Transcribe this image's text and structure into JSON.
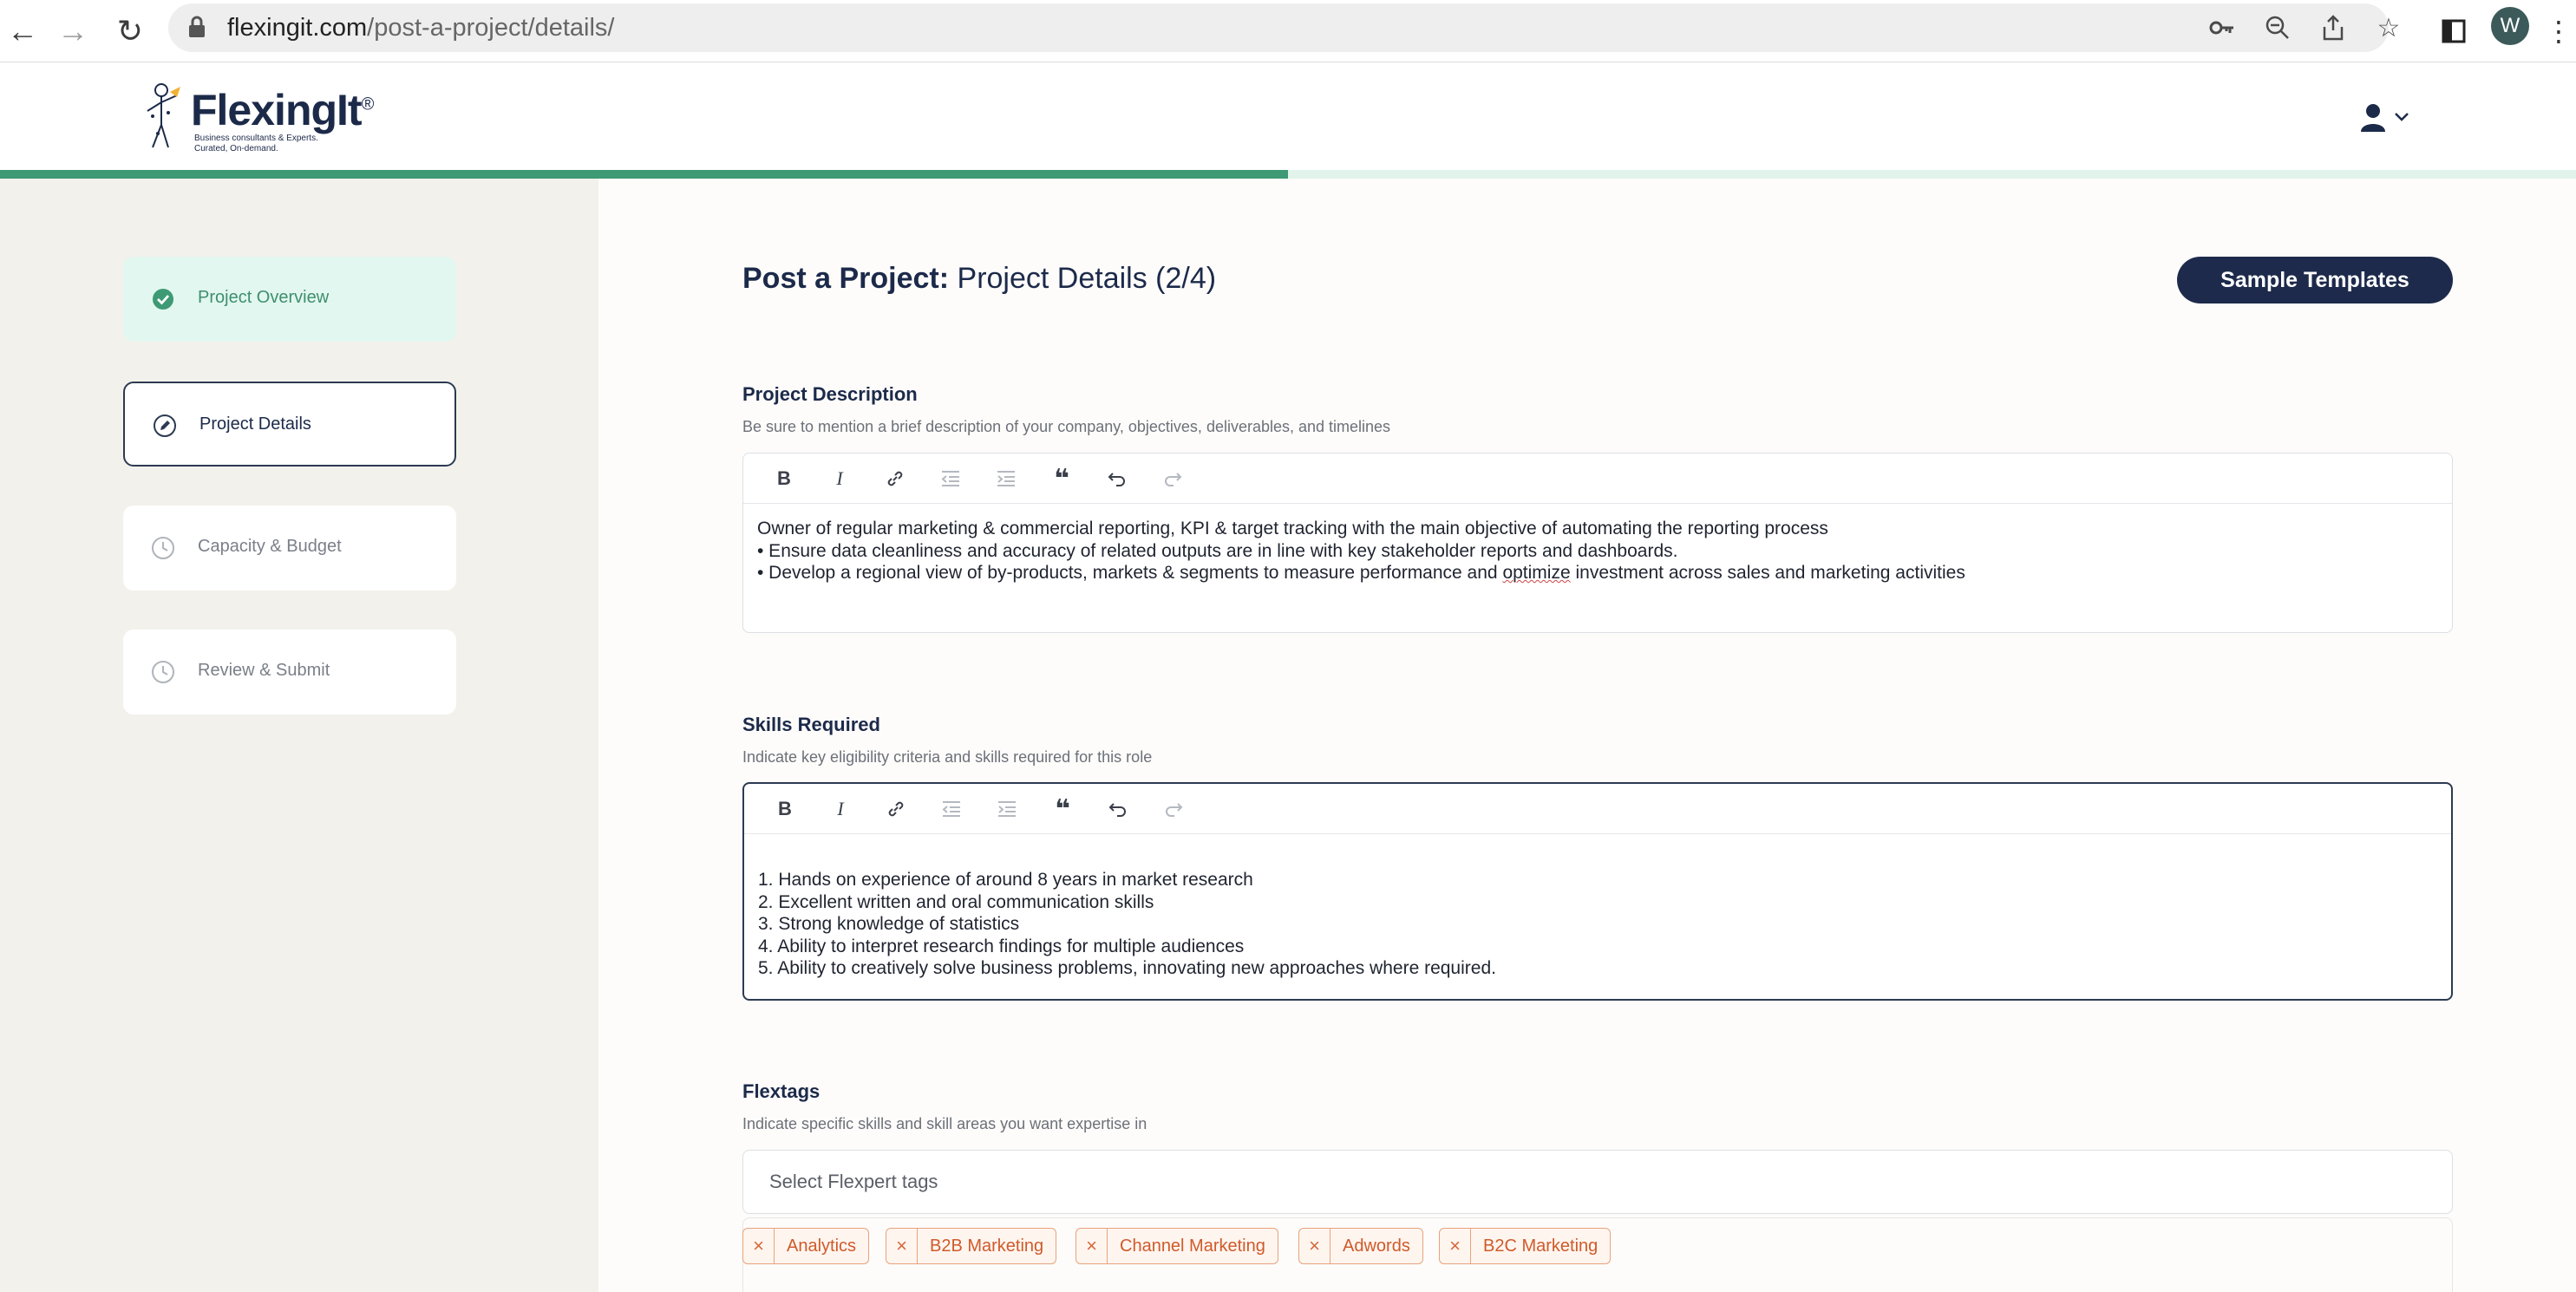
{
  "browser": {
    "url_host": "flexingit.com",
    "url_path": "/post-a-project/details/",
    "profile_initial": "W"
  },
  "brand": {
    "name": "FlexingIt",
    "reg": "®",
    "tagline_1": "Business consultants & Experts.",
    "tagline_2": "Curated, On-demand."
  },
  "progress": {
    "fraction": 0.5
  },
  "steps": [
    {
      "label": "Project Overview",
      "state": "done"
    },
    {
      "label": "Project Details",
      "state": "active"
    },
    {
      "label": "Capacity & Budget",
      "state": "pending"
    },
    {
      "label": "Review & Submit",
      "state": "pending"
    }
  ],
  "page": {
    "title_bold": "Post a Project:",
    "title_rest": " Project Details (2/4)",
    "sample_templates_label": "Sample Templates"
  },
  "description": {
    "title": "Project Description",
    "hint": "Be sure to mention a brief description of your company, objectives, deliverables, and timelines",
    "line_1": "Owner of regular marketing & commercial reporting, KPI & target tracking with the main objective of automating the reporting process",
    "line_2": "• Ensure data cleanliness and accuracy of related outputs are in line with key stakeholder reports and dashboards.",
    "line_3_a": "• Develop a regional view of by-products, markets & segments to measure performance and ",
    "line_3_spell": "optimize",
    "line_3_b": " investment across sales and marketing activities"
  },
  "skills": {
    "title": "Skills Required",
    "hint": "Indicate key eligibility criteria and skills required for this role",
    "items": [
      "1. Hands on experience of around 8 years in market research",
      "2. Excellent written and oral communication skills",
      "3. Strong knowledge of statistics",
      "4. Ability to interpret research findings for multiple audiences",
      "5. Ability to creatively solve business problems, innovating new approaches where required."
    ]
  },
  "flextags": {
    "title": "Flextags",
    "hint": "Indicate specific skills and skill areas you want expertise in",
    "placeholder": "Select Flexpert tags",
    "tags": [
      "Analytics",
      "B2B Marketing",
      "Channel Marketing",
      "Adwords",
      "B2C Marketing"
    ]
  },
  "colors": {
    "brand_navy": "#1d2a4b",
    "progress_green": "#3e9a74",
    "done_bg": "#e2f7ef",
    "chip_orange": "#cf5a2a"
  }
}
